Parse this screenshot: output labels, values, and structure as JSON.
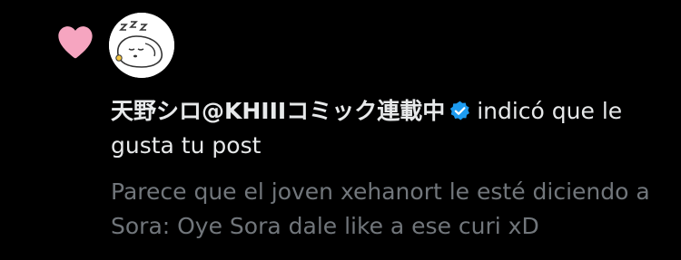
{
  "notification": {
    "type_icon": "heart-icon",
    "avatar_icon": "sleeping-character-avatar",
    "user_name": "天野シロ@KHIIIコミック連載中",
    "verified_icon": "verified-badge-icon",
    "action_text": "indicó que le gusta tu post",
    "post_excerpt": "Parece que el joven xehanort le esté diciendo a Sora: Oye Sora dale like a ese curi xD"
  },
  "colors": {
    "background": "#000000",
    "heart": "#f6a5c0",
    "primary_text": "#e7e9ea",
    "secondary_text": "#71767b",
    "verified": "#1d9bf0"
  }
}
